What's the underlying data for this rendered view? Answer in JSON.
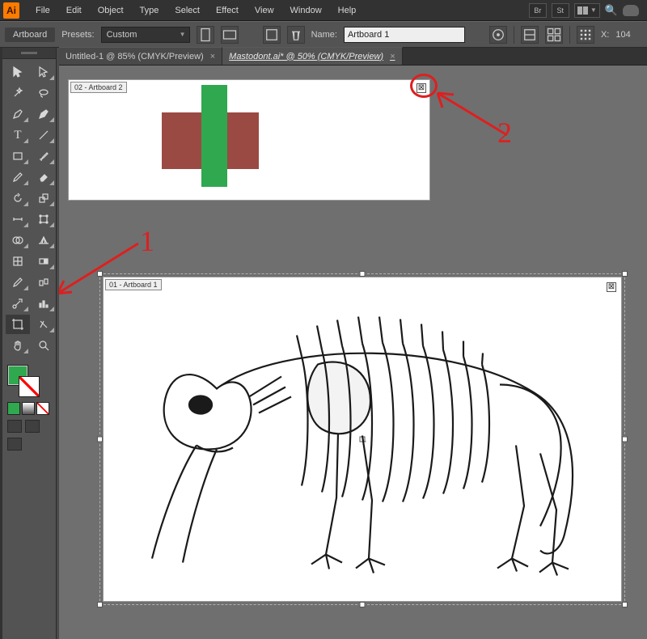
{
  "app": {
    "icon_label": "Ai"
  },
  "menu": [
    "File",
    "Edit",
    "Object",
    "Type",
    "Select",
    "Effect",
    "View",
    "Window",
    "Help"
  ],
  "top_right": {
    "chip1": "Br",
    "chip2": "St"
  },
  "controlbar": {
    "panel_label": "Artboard",
    "presets_label": "Presets:",
    "presets_value": "Custom",
    "name_label": "Name:",
    "name_value": "Artboard 1",
    "x_label": "X:",
    "x_value": "104"
  },
  "tabs": [
    {
      "label": "Untitled-1 @ 85% (CMYK/Preview)",
      "active": false
    },
    {
      "label": "Mastodont.ai* @ 50% (CMYK/Preview)",
      "active": true
    }
  ],
  "artboards": {
    "ab2_label": "02 - Artboard 2",
    "ab1_label": "01 - Artboard 1"
  },
  "swatches": {
    "fill": "#2fa84f",
    "mini": [
      "#2fa84f",
      "#bfbfbf",
      "#ffffff"
    ]
  },
  "annotations": {
    "one": "1",
    "two": "2"
  }
}
